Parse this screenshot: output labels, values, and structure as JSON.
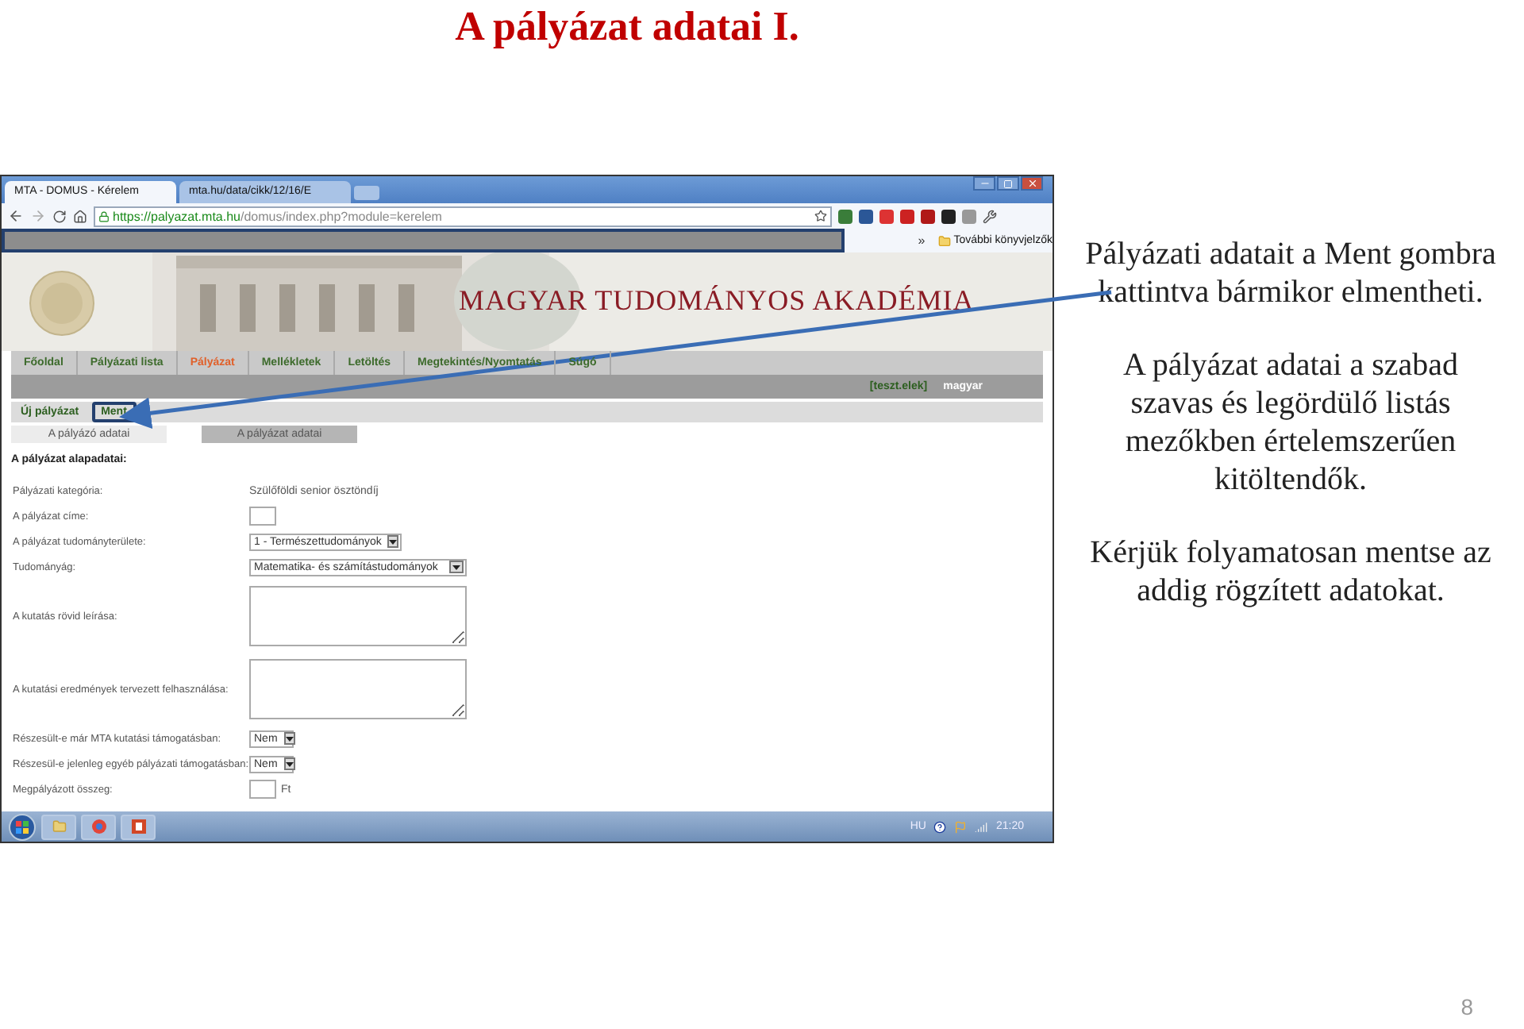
{
  "slide_title": "A pályázat adatai I.",
  "browser": {
    "tabs": [
      {
        "label": "MTA - DOMUS - Kérelem",
        "selected": true
      },
      {
        "label": "mta.hu/data/cikk/12/16/E",
        "selected": false
      }
    ],
    "url_host": "https://palyazat.mta.hu",
    "url_path": "/domus/index.php?module=kerelem",
    "bookmarks_highlighted": true,
    "bookmarks_chevron": "»",
    "bookmarks_folder": "További könyvjelzők"
  },
  "site": {
    "title": "MAGYAR TUDOMÁNYOS AKADÉMIA",
    "nav": [
      {
        "label": "Főoldal",
        "selected": false
      },
      {
        "label": "Pályázati lista",
        "selected": false
      },
      {
        "label": "Pályázat",
        "selected": true
      },
      {
        "label": "Mellékletek",
        "selected": false
      },
      {
        "label": "Letöltés",
        "selected": false
      },
      {
        "label": "Megtekintés/Nyomtatás",
        "selected": false
      },
      {
        "label": "Súgó",
        "selected": false
      }
    ],
    "user": "[teszt.elek]",
    "language": "magyar",
    "actions": [
      {
        "label": "Új pályázat",
        "highlighted": false
      },
      {
        "label": "Ment",
        "highlighted": true
      }
    ],
    "form_tabs": [
      {
        "label": "A pályázó adatai",
        "selected": false
      },
      {
        "label": "A pályázat adatai",
        "selected": true
      }
    ],
    "section_heading": "A pályázat alapadatai:",
    "fields": [
      {
        "kind": "static",
        "label": "Pályázati kategória:",
        "value": "Szülőföldi senior ösztöndíj"
      },
      {
        "kind": "input",
        "label": "A pályázat címe:"
      },
      {
        "kind": "select",
        "label": "A pályázat tudományterülete:",
        "value": "1 - Természettudományok"
      },
      {
        "kind": "select",
        "label": "Tudományág:",
        "value": "Matematika- és számítástudományok"
      },
      {
        "kind": "textarea",
        "label": "A kutatás rövid leírása:"
      },
      {
        "kind": "textarea",
        "label": "A kutatási eredmények tervezett felhasználása:"
      },
      {
        "kind": "select",
        "label": "Részesült-e már MTA kutatási támogatásban:",
        "value": "Nem"
      },
      {
        "kind": "select",
        "label": "Részesül-e jelenleg egyéb pályázati támogatásban:",
        "value": "Nem"
      },
      {
        "kind": "input",
        "label": "Megpályázott összeg:",
        "unit": "Ft"
      }
    ]
  },
  "taskbar": {
    "language": "HU",
    "time": "21:20"
  },
  "notes": [
    "Pályázati adatait a Ment gombra kattintva bármikor elmentheti.",
    "A pályázat adatai a szabad szavas és legördülő listás mezőkben értelemszerűen kitöltendők.",
    "Kérjük folyamatosan mentse az addig rögzített adatokat."
  ],
  "page_number": "8"
}
